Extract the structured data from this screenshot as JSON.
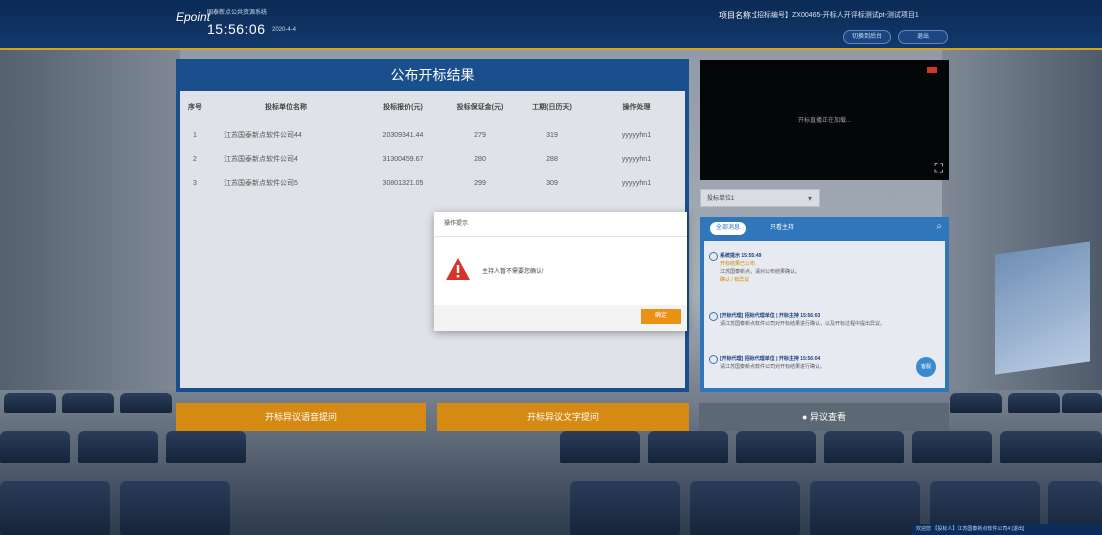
{
  "header": {
    "logo": "Epoint",
    "system_name": "国泰新点公共资源系统",
    "time": "15:56:06",
    "date": "2020-4-4",
    "project_label": "项目名称：",
    "project_value": "【招标编号】ZX00465-开标人开评标测试pt-测试项目1",
    "buttons": [
      "切换到后台",
      "退出"
    ]
  },
  "panel": {
    "title": "公布开标结果",
    "columns": [
      "序号",
      "投标单位名称",
      "投标报价(元)",
      "投标保证金(元)",
      "工期(日历天)",
      "操作处理"
    ],
    "rows": [
      {
        "no": "1",
        "name": "江苏国泰新点软件公司44",
        "price": "20309341.44",
        "deposit": "279",
        "period": "319",
        "op": "yyyyyhn1"
      },
      {
        "no": "2",
        "name": "江苏国泰新点软件公司4",
        "price": "31300459.67",
        "deposit": "280",
        "period": "288",
        "op": "yyyyyhn1"
      },
      {
        "no": "3",
        "name": "江苏国泰新点软件公司5",
        "price": "30801321.05",
        "deposit": "299",
        "period": "309",
        "op": "yyyyyhn1"
      }
    ]
  },
  "video": {
    "placeholder": "开标直播正在加载..."
  },
  "select": {
    "value": "投标单位1"
  },
  "chat": {
    "tabs": [
      "全部消息",
      "只看主持"
    ],
    "messages": [
      {
        "head": "系统提示 15:55:49",
        "lines": [
          "开标结果已公布",
          "江苏国泰新点，请对公布结果确认。",
          "确认 / 有异议"
        ]
      },
      {
        "head": "[开标代理] 招标代理单位 | 开标主持 15:56:03",
        "lines": [
          "请江苏国泰新点软件公司对开标结果进行确认，以及开标过程中提出异议。"
        ]
      },
      {
        "head": "[开标代理] 招标代理单位 | 开标主持 15:56:04",
        "lines": [
          "请江苏国泰新点软件公司对开标结果进行确认。"
        ]
      }
    ],
    "float_button": "客服"
  },
  "actions": {
    "voice_objection": "开标异议语音提问",
    "text_objection": "开标异议文字提问",
    "view_objection": "异议查看"
  },
  "modal": {
    "title": "操作提示",
    "message": "主持人暂不需要您确认!",
    "ok": "确定"
  },
  "status_bar": {
    "text": "欢迎您 【投标人】江苏国泰新点软件公司4 [退出]"
  },
  "colors": {
    "header_bg": "#0b2a55",
    "panel_bg": "#184f8c",
    "accent_orange": "#eb9214",
    "chat_blue": "#2f76bb",
    "warning_red": "#d8332b"
  }
}
